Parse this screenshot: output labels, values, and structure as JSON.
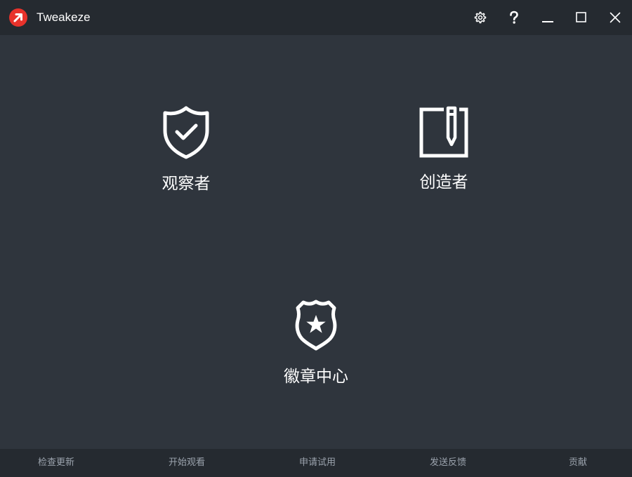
{
  "app": {
    "title": "Tweakeze",
    "logo_icon": "tweakeze-logo-icon",
    "accent_color": "#e8322b"
  },
  "titlebar": {
    "buttons": [
      {
        "icon": "gear-icon"
      },
      {
        "icon": "help-icon"
      },
      {
        "icon": "minimize-icon"
      },
      {
        "icon": "maximize-icon"
      },
      {
        "icon": "close-icon"
      }
    ]
  },
  "main": {
    "tiles": [
      {
        "label": "观察者",
        "icon": "shield-check-icon"
      },
      {
        "label": "创造者",
        "icon": "notebook-pen-icon"
      },
      {
        "label": "徽章中心",
        "icon": "badge-star-icon"
      }
    ]
  },
  "footer": {
    "links": [
      {
        "label": "检查更新"
      },
      {
        "label": "开始观看"
      },
      {
        "label": "申请试用"
      },
      {
        "label": "发送反馈"
      },
      {
        "label": "贡献"
      }
    ]
  },
  "colors": {
    "background": "#2f353d",
    "titlebar": "#252a30",
    "footer": "#252a30",
    "footer_text": "#9ba3ad"
  }
}
